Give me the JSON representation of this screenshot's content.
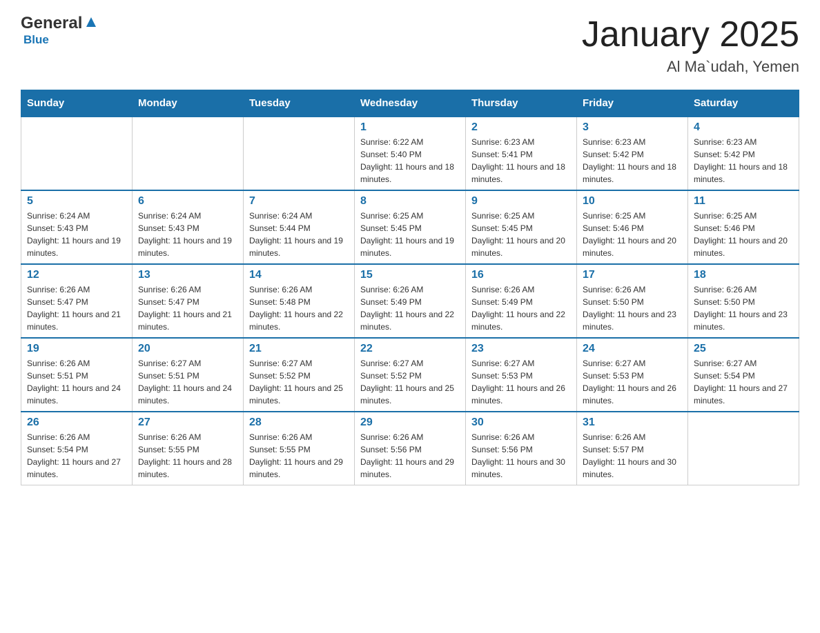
{
  "header": {
    "logo_general": "General",
    "logo_blue": "Blue",
    "title": "January 2025",
    "subtitle": "Al Ma`udah, Yemen"
  },
  "days_of_week": [
    "Sunday",
    "Monday",
    "Tuesday",
    "Wednesday",
    "Thursday",
    "Friday",
    "Saturday"
  ],
  "weeks": [
    [
      {
        "day": "",
        "info": ""
      },
      {
        "day": "",
        "info": ""
      },
      {
        "day": "",
        "info": ""
      },
      {
        "day": "1",
        "info": "Sunrise: 6:22 AM\nSunset: 5:40 PM\nDaylight: 11 hours and 18 minutes."
      },
      {
        "day": "2",
        "info": "Sunrise: 6:23 AM\nSunset: 5:41 PM\nDaylight: 11 hours and 18 minutes."
      },
      {
        "day": "3",
        "info": "Sunrise: 6:23 AM\nSunset: 5:42 PM\nDaylight: 11 hours and 18 minutes."
      },
      {
        "day": "4",
        "info": "Sunrise: 6:23 AM\nSunset: 5:42 PM\nDaylight: 11 hours and 18 minutes."
      }
    ],
    [
      {
        "day": "5",
        "info": "Sunrise: 6:24 AM\nSunset: 5:43 PM\nDaylight: 11 hours and 19 minutes."
      },
      {
        "day": "6",
        "info": "Sunrise: 6:24 AM\nSunset: 5:43 PM\nDaylight: 11 hours and 19 minutes."
      },
      {
        "day": "7",
        "info": "Sunrise: 6:24 AM\nSunset: 5:44 PM\nDaylight: 11 hours and 19 minutes."
      },
      {
        "day": "8",
        "info": "Sunrise: 6:25 AM\nSunset: 5:45 PM\nDaylight: 11 hours and 19 minutes."
      },
      {
        "day": "9",
        "info": "Sunrise: 6:25 AM\nSunset: 5:45 PM\nDaylight: 11 hours and 20 minutes."
      },
      {
        "day": "10",
        "info": "Sunrise: 6:25 AM\nSunset: 5:46 PM\nDaylight: 11 hours and 20 minutes."
      },
      {
        "day": "11",
        "info": "Sunrise: 6:25 AM\nSunset: 5:46 PM\nDaylight: 11 hours and 20 minutes."
      }
    ],
    [
      {
        "day": "12",
        "info": "Sunrise: 6:26 AM\nSunset: 5:47 PM\nDaylight: 11 hours and 21 minutes."
      },
      {
        "day": "13",
        "info": "Sunrise: 6:26 AM\nSunset: 5:47 PM\nDaylight: 11 hours and 21 minutes."
      },
      {
        "day": "14",
        "info": "Sunrise: 6:26 AM\nSunset: 5:48 PM\nDaylight: 11 hours and 22 minutes."
      },
      {
        "day": "15",
        "info": "Sunrise: 6:26 AM\nSunset: 5:49 PM\nDaylight: 11 hours and 22 minutes."
      },
      {
        "day": "16",
        "info": "Sunrise: 6:26 AM\nSunset: 5:49 PM\nDaylight: 11 hours and 22 minutes."
      },
      {
        "day": "17",
        "info": "Sunrise: 6:26 AM\nSunset: 5:50 PM\nDaylight: 11 hours and 23 minutes."
      },
      {
        "day": "18",
        "info": "Sunrise: 6:26 AM\nSunset: 5:50 PM\nDaylight: 11 hours and 23 minutes."
      }
    ],
    [
      {
        "day": "19",
        "info": "Sunrise: 6:26 AM\nSunset: 5:51 PM\nDaylight: 11 hours and 24 minutes."
      },
      {
        "day": "20",
        "info": "Sunrise: 6:27 AM\nSunset: 5:51 PM\nDaylight: 11 hours and 24 minutes."
      },
      {
        "day": "21",
        "info": "Sunrise: 6:27 AM\nSunset: 5:52 PM\nDaylight: 11 hours and 25 minutes."
      },
      {
        "day": "22",
        "info": "Sunrise: 6:27 AM\nSunset: 5:52 PM\nDaylight: 11 hours and 25 minutes."
      },
      {
        "day": "23",
        "info": "Sunrise: 6:27 AM\nSunset: 5:53 PM\nDaylight: 11 hours and 26 minutes."
      },
      {
        "day": "24",
        "info": "Sunrise: 6:27 AM\nSunset: 5:53 PM\nDaylight: 11 hours and 26 minutes."
      },
      {
        "day": "25",
        "info": "Sunrise: 6:27 AM\nSunset: 5:54 PM\nDaylight: 11 hours and 27 minutes."
      }
    ],
    [
      {
        "day": "26",
        "info": "Sunrise: 6:26 AM\nSunset: 5:54 PM\nDaylight: 11 hours and 27 minutes."
      },
      {
        "day": "27",
        "info": "Sunrise: 6:26 AM\nSunset: 5:55 PM\nDaylight: 11 hours and 28 minutes."
      },
      {
        "day": "28",
        "info": "Sunrise: 6:26 AM\nSunset: 5:55 PM\nDaylight: 11 hours and 29 minutes."
      },
      {
        "day": "29",
        "info": "Sunrise: 6:26 AM\nSunset: 5:56 PM\nDaylight: 11 hours and 29 minutes."
      },
      {
        "day": "30",
        "info": "Sunrise: 6:26 AM\nSunset: 5:56 PM\nDaylight: 11 hours and 30 minutes."
      },
      {
        "day": "31",
        "info": "Sunrise: 6:26 AM\nSunset: 5:57 PM\nDaylight: 11 hours and 30 minutes."
      },
      {
        "day": "",
        "info": ""
      }
    ]
  ]
}
